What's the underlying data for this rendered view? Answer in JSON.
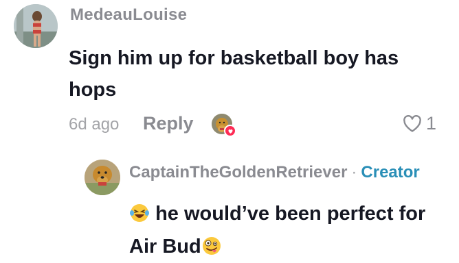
{
  "comment": {
    "username": "MedeauLouise",
    "text": "Sign him up for basketball boy has hops",
    "time": "6d ago",
    "reply_label": "Reply",
    "like_count": "1",
    "liked_by_creator": true
  },
  "reply": {
    "username": "CaptainTheGoldenRetriever",
    "separator": "·",
    "badge": "Creator",
    "text_part1": "he would’ve been perfect for Air Bud",
    "leading_emoji": "laughing-crying-emoji",
    "trailing_emoji": "zany-face-emoji"
  },
  "colors": {
    "username": "#8a8b91",
    "text": "#161823",
    "creator": "#2a8fb7",
    "heart_badge": "#fe2c55"
  }
}
